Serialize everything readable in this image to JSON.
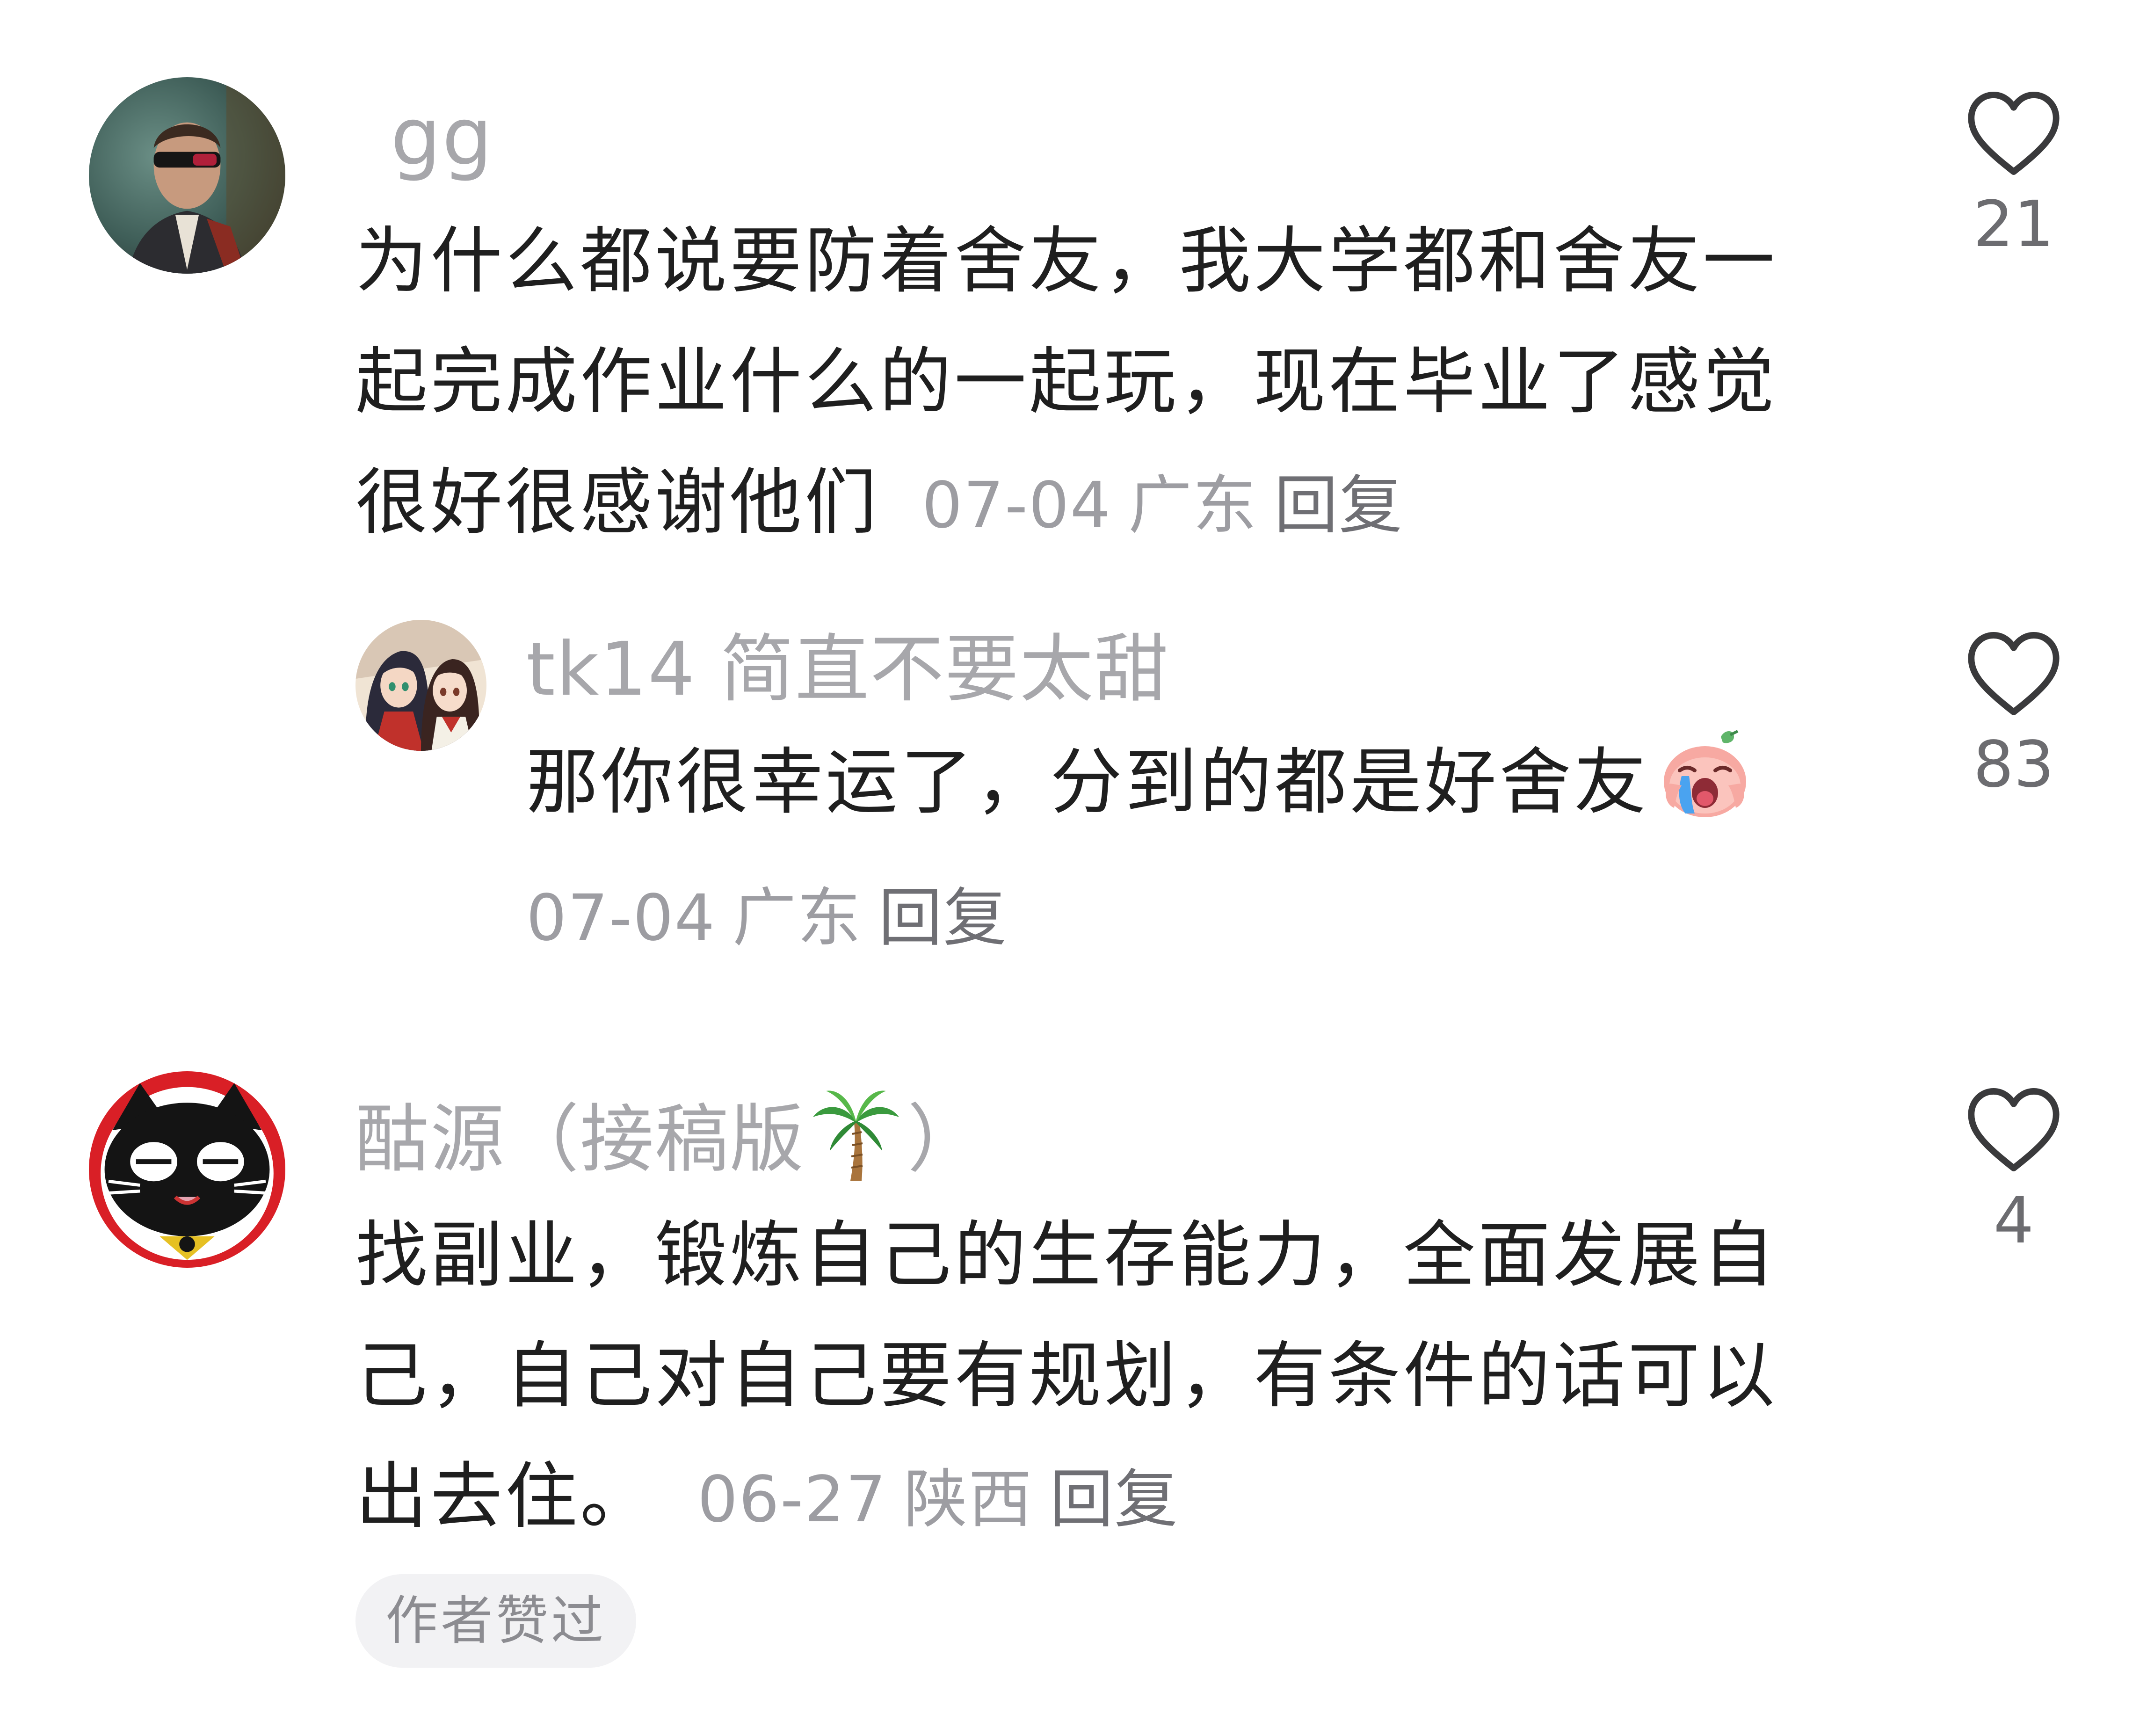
{
  "comments": [
    {
      "username": "gg",
      "text": "为什么都说要防着舍友，我大学都和舍友一起完成作业什么的一起玩，现在毕业了感觉很好很感谢他们",
      "date": "07-04",
      "location": "广东",
      "reply_label": "回复",
      "likes": "21",
      "avatar_icon": "profile-photo-man-sunglasses"
    },
    {
      "username": "tk14 简直不要太甜",
      "text": "那你很幸运了，分到的都是好舍友",
      "emoji": "crying-face-emoji",
      "date": "07-04",
      "location": "广东",
      "reply_label": "回复",
      "likes": "83",
      "avatar_icon": "anime-girls-avatar"
    },
    {
      "username_prefix": "酤源（接稿版",
      "username_emoji": "palm-tree-emoji",
      "username_suffix": "）",
      "text": "找副业，锻炼自己的生存能力，全面发展自己，自己对自己要有规划，有条件的话可以出去住。",
      "date": "06-27",
      "location": "陕西",
      "reply_label": "回复",
      "likes": "4",
      "author_badge": "作者赞过",
      "avatar_icon": "cartoon-cat-avatar"
    }
  ],
  "colors": {
    "username": "#a7a7ab",
    "text": "#1f1f1f",
    "meta": "#9d9da2",
    "badge_bg": "#f2f2f4"
  }
}
